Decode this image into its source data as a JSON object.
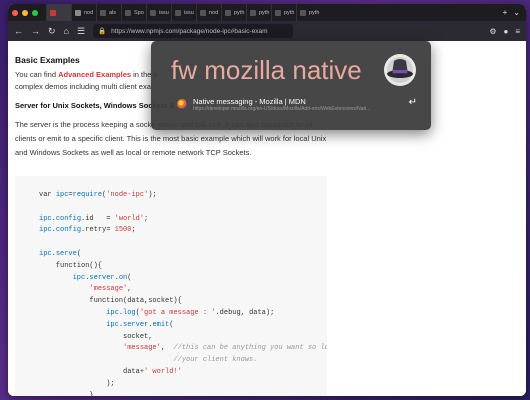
{
  "browser": {
    "tabs": [
      {
        "label": "",
        "active": true,
        "color": "#cb3837"
      },
      {
        "label": "nod",
        "active": false,
        "color": "#8a8a8a"
      },
      {
        "label": "als",
        "active": false,
        "color": "#555"
      },
      {
        "label": "Spo",
        "active": false,
        "color": "#555"
      },
      {
        "label": "issu",
        "active": false,
        "color": "#555"
      },
      {
        "label": "issu",
        "active": false,
        "color": "#555"
      },
      {
        "label": "nod",
        "active": false,
        "color": "#555"
      },
      {
        "label": "pyth",
        "active": false,
        "color": "#555"
      },
      {
        "label": "pyth",
        "active": false,
        "color": "#555"
      },
      {
        "label": "pyth",
        "active": false,
        "color": "#555"
      },
      {
        "label": "pyth",
        "active": false,
        "color": "#555"
      }
    ],
    "url": "https://www.npmjs.com/package/node-ipc#basic-exam",
    "new_tab": "+"
  },
  "page": {
    "heading": "Basic Examples",
    "intro_before": "You can find ",
    "intro_link": "Advanced Examples",
    "intro_after": " in the e",
    "intro_line2": "complex demos including multi client exa",
    "subheading": "Server for Unix Sockets, Windows Sockets &",
    "body": "The server is the process keeping a socke server and talk to it. It can also broadcast to all clients or emit to a specific client. This is the most basic example which will work for local Unix and Windows Sockets as well as local or remote network TCP Sockets.",
    "code_lines": [
      "var ipc=require('node-ipc');",
      "",
      "ipc.config.id   = 'world';",
      "ipc.config.retry= 1500;",
      "",
      "ipc.serve(",
      "    function(){",
      "        ipc.server.on(",
      "            'message',",
      "            function(data,socket){",
      "                ipc.log('got a message : '.debug, data);",
      "                ipc.server.emit(",
      "                    socket,",
      "                    'message',  //this can be anything you want so lo",
      "                                //your client knows.",
      "                    data+' world!'",
      "                );",
      "            }"
    ]
  },
  "launcher": {
    "query": "fw mozilla native",
    "result_title": "Native messaging - Mozilla | MDN",
    "result_url": "https://developer.mozilla.org/en-US/docs/Mozilla/Add-ons/WebExtensions/Nati...",
    "enter_glyph": "↵"
  },
  "colors": {
    "npm_red": "#cb3837",
    "launcher_query": "#e8a9a0"
  }
}
